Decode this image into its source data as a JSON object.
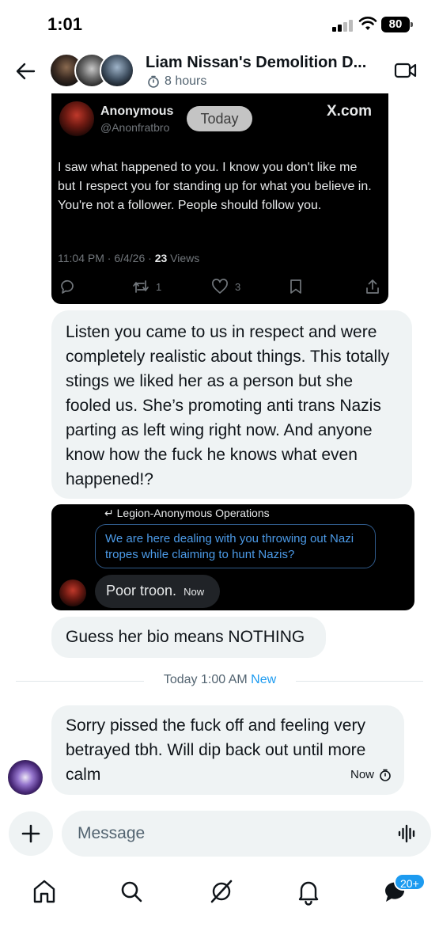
{
  "status_bar": {
    "time": "1:01",
    "battery": "80"
  },
  "header": {
    "title": "Liam Nissan's Demolition D...",
    "subtitle": "8 hours"
  },
  "tweet": {
    "name": "Anonymous",
    "handle": "@Anonfratbro",
    "date_pill": "Today",
    "source": "X.com",
    "text": "I saw what happened to you. I know you don't like me but I respect you for standing up for what you believe in. You're not a follower. People should follow you.",
    "meta_prefix": "11:04 PM · 6/4/26 · ",
    "views_count": "23",
    "views_label": " Views",
    "reposts": "1",
    "likes": "3"
  },
  "messages": {
    "m1": "Listen you came to us in respect and were completely realistic about things. This totally stings we liked her as a person but she fooled us. She’s promoting anti trans Nazis parting as left wing right now. And anyone know how the fuck he knows what even happened!?",
    "reply_context": "Legion-Anonymous Operations",
    "quoted": "We are here dealing with you throwing out Nazi tropes while claiming to hunt Nazis?",
    "reply_text": "Poor troon.",
    "reply_time": "Now",
    "m2": "Guess her bio means NOTHING",
    "m3": "Sorry pissed the fuck off and feeling very betrayed tbh. Will dip back out until more calm",
    "m3_time": "Now"
  },
  "divider": {
    "time": "Today 1:00 AM",
    "new_label": "New"
  },
  "composer": {
    "placeholder": "Message"
  },
  "nav": {
    "badge": "20+"
  },
  "colors": {
    "accent": "#1d9bf0",
    "bubble": "#eff3f4",
    "dark_card": "#000000",
    "link_blue": "#4c9be8"
  }
}
